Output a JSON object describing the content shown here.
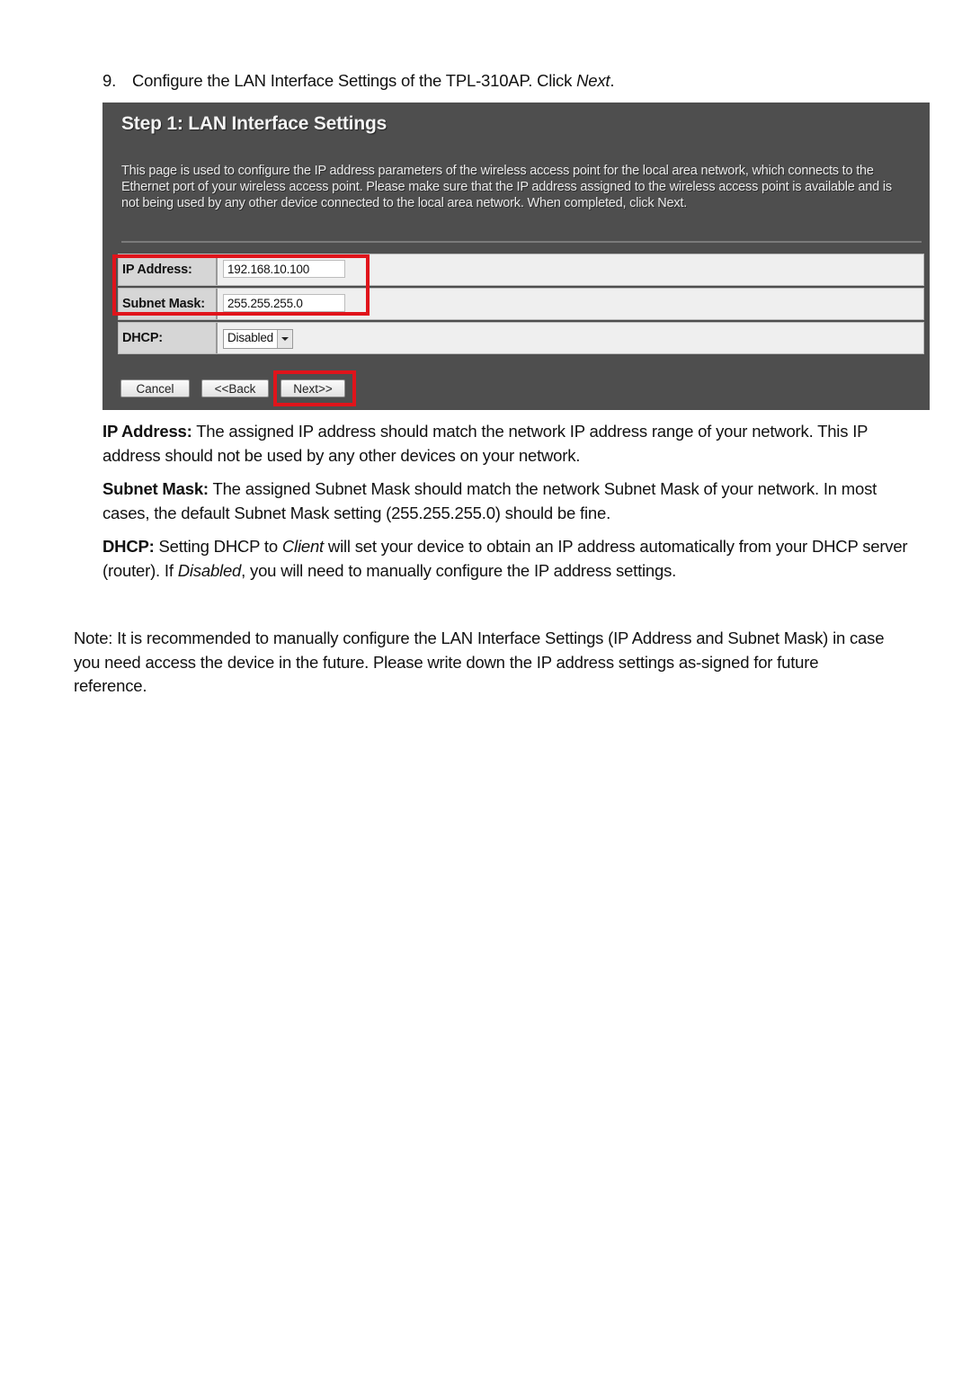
{
  "step": {
    "number": "9.",
    "text_before": "Configure the LAN Interface Settings of the TPL-310AP. Click ",
    "text_italic": "Next",
    "text_after": "."
  },
  "panel": {
    "title": "Step 1: LAN Interface Settings",
    "description": "This page is used to configure the IP address parameters of the wireless access point for the local area network, which connects to the Ethernet port of your wireless access point. Please make sure that the IP address assigned to the wireless access point is available and is not being used by any other device connected to the local area network. When completed, click Next.",
    "fields": {
      "ip_address": {
        "label": "IP Address:",
        "value": "192.168.10.100"
      },
      "subnet_mask": {
        "label": "Subnet Mask:",
        "value": "255.255.255.0"
      },
      "dhcp": {
        "label": "DHCP:",
        "selected": "Disabled"
      }
    },
    "buttons": {
      "cancel": "Cancel",
      "back": "<<Back",
      "next": "Next>>"
    },
    "highlight_color": "#e0141b",
    "background_color": "#4e4e4e"
  },
  "descriptions": {
    "ip_address": {
      "term": "IP Address:",
      "text": " The assigned IP address should match the network IP address range of your network. This IP address should not be used by any other devices on your network."
    },
    "subnet_mask": {
      "term": "Subnet Mask:",
      "text": " The assigned Subnet Mask should match the network Subnet Mask of your network. In most cases, the default Subnet Mask setting (255.255.255.0) should be fine."
    },
    "dhcp": {
      "term": "DHCP:",
      "text_1": " Setting DHCP to ",
      "italic_1": "Client",
      "text_2": " will set your device to obtain an IP address automatically from your DHCP server (router). If ",
      "italic_2": "Disabled",
      "text_3": ", you will need to manually configure the IP address settings."
    }
  },
  "note": "Note: It is recommended to manually configure the LAN Interface Settings (IP Address and Subnet Mask) in case you need access the device in the future. Please write down the IP address settings as-signed for future reference."
}
